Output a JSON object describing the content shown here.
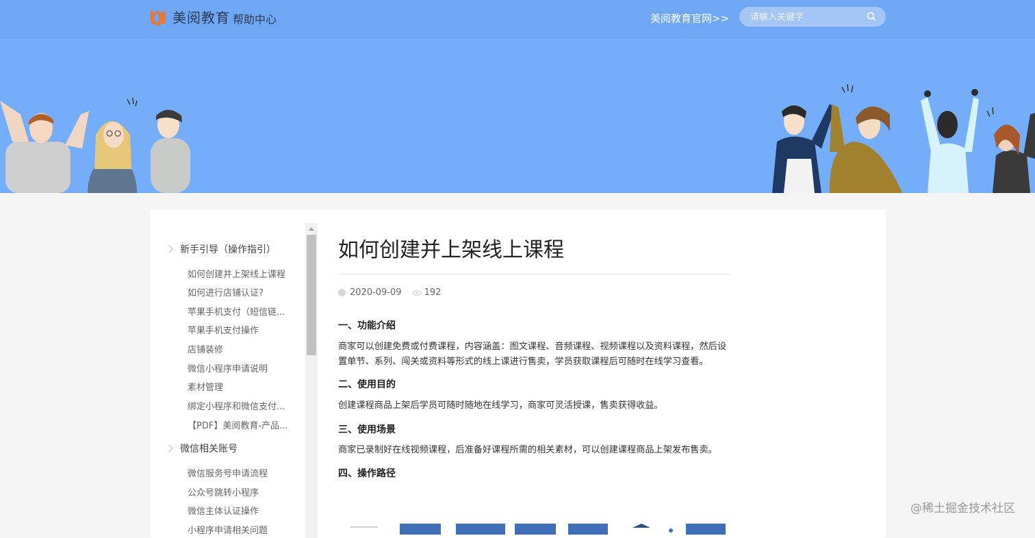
{
  "header": {
    "brand": "美阅教育",
    "brand_sub": "帮助中心",
    "official_link": "美阅教育官网>>",
    "search_placeholder": "请输入关键字"
  },
  "sidebar": {
    "groups": [
      {
        "title": "新手引导（操作指引）",
        "items": [
          "如何创建并上架线上课程",
          "如何进行店铺认证?",
          "苹果手机支付（短信链...",
          "苹果手机支付操作",
          "店铺装修",
          "微信小程序申请说明",
          "素材管理",
          "绑定小程序和微信支付...",
          "【PDF】美阅教育-产品..."
        ]
      },
      {
        "title": "微信相关账号",
        "items": [
          "微信服务号申请流程",
          "公众号跳转小程序",
          "微信主体认证操作",
          "小程序申请相关问题"
        ]
      }
    ]
  },
  "article": {
    "title": "如何创建并上架线上课程",
    "date": "2020-09-09",
    "views": "192",
    "sections": [
      {
        "heading": "一、功能介绍",
        "text": "商家可以创建免费或付费课程，内容涵盖：图文课程、音频课程、视频课程以及资料课程，然后设置单节、系列、闯关或资料等形式的线上课进行售卖，学员获取课程后可随时在线学习查看。"
      },
      {
        "heading": "二、使用目的",
        "text": "创建课程商品上架后学员可随时随地在线学习，商家可灵活授课，售卖获得收益。"
      },
      {
        "heading": "三、使用场景",
        "text": "商家已录制好在线视频课程，后准备好课程所需的相关素材，可以创建课程商品上架发布售卖。"
      },
      {
        "heading": "四、操作路径",
        "text": ""
      }
    ]
  },
  "watermark": "@稀土掘金技术社区",
  "colors": {
    "topbar": "#6ea7f4",
    "banner": "#74aefb",
    "logo_orange": "#e8793b"
  }
}
